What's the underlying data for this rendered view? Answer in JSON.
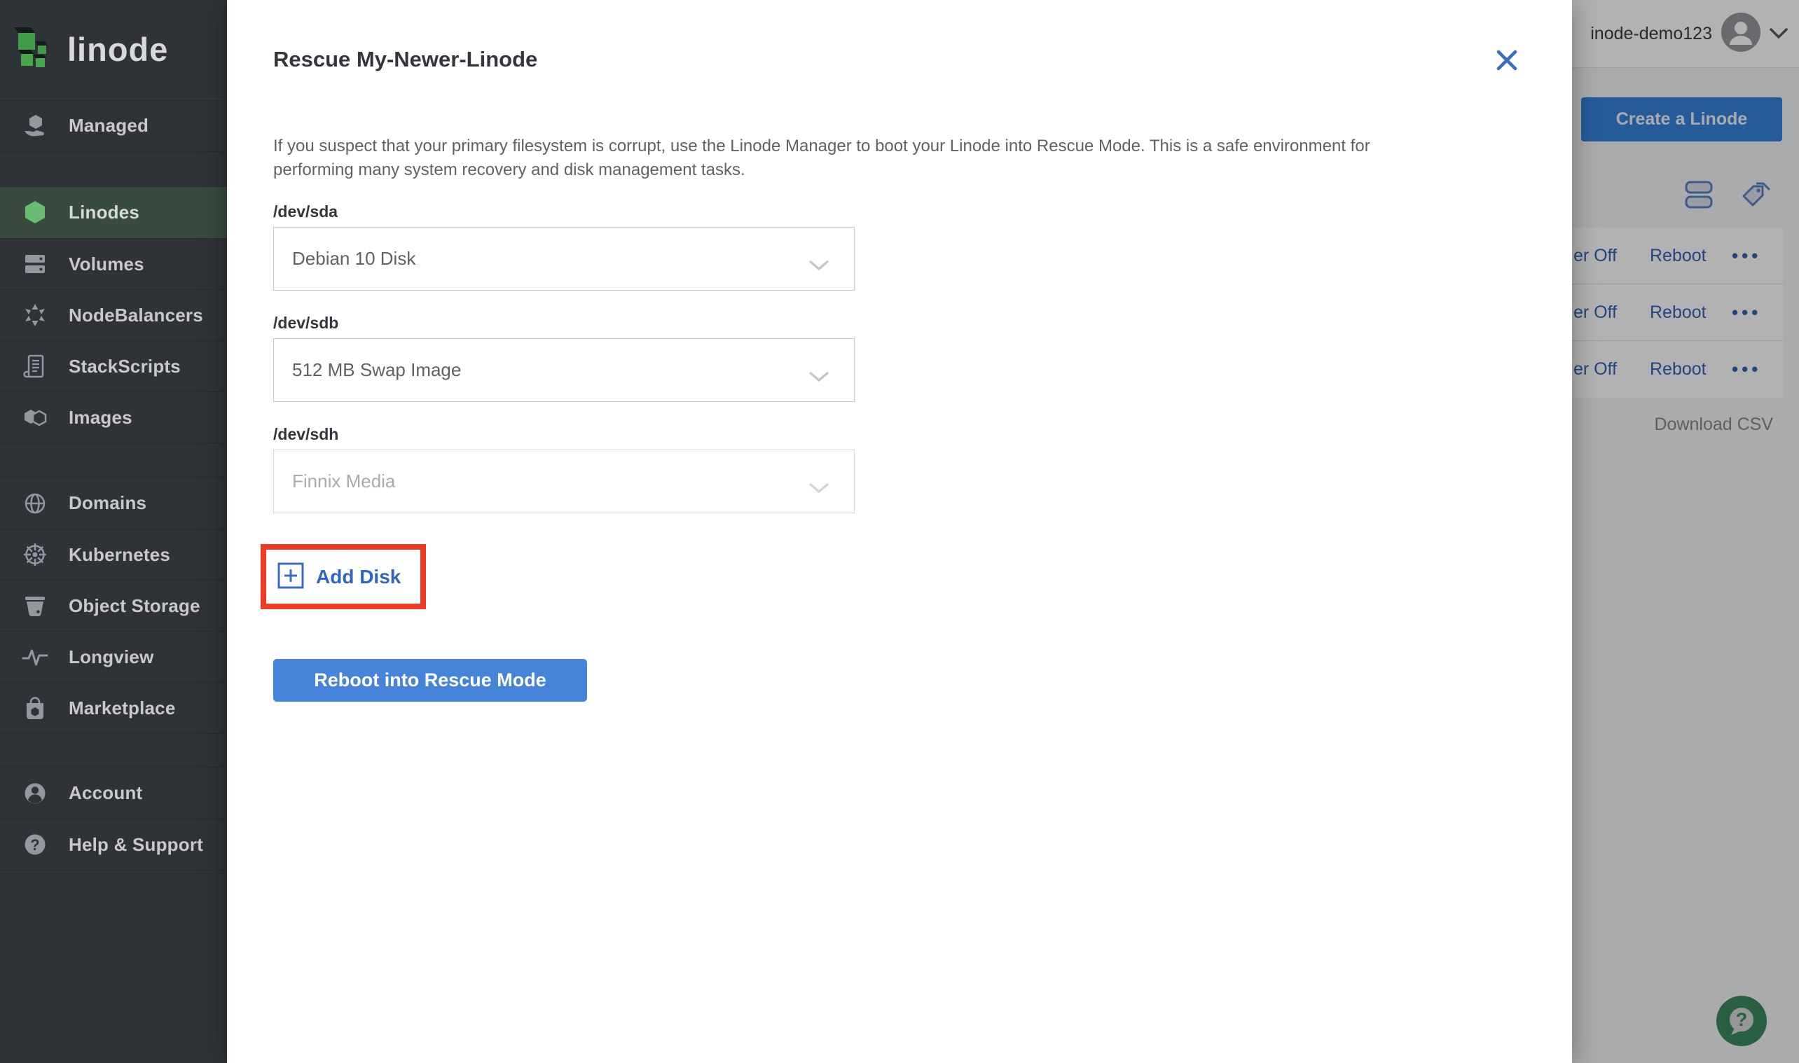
{
  "colors": {
    "accent_blue": "#3683dc",
    "link_blue": "#2f66c2",
    "sidebar_bg": "#2f3338",
    "active_green": "#6abc71",
    "annotation_red": "#ee3b23"
  },
  "sidebar": {
    "logo_text": "linode",
    "logo_icon": "linode-logo-icon",
    "groups": [
      {
        "items": [
          {
            "label": "Managed",
            "icon": "managed-icon",
            "active": false
          }
        ]
      },
      {
        "items": [
          {
            "label": "Linodes",
            "icon": "linodes-icon",
            "active": true
          },
          {
            "label": "Volumes",
            "icon": "volumes-icon",
            "active": false
          },
          {
            "label": "NodeBalancers",
            "icon": "nodebalancers-icon",
            "active": false
          },
          {
            "label": "StackScripts",
            "icon": "stackscripts-icon",
            "active": false
          },
          {
            "label": "Images",
            "icon": "images-icon",
            "active": false
          }
        ]
      },
      {
        "items": [
          {
            "label": "Domains",
            "icon": "domains-icon",
            "active": false
          },
          {
            "label": "Kubernetes",
            "icon": "kubernetes-icon",
            "active": false
          },
          {
            "label": "Object Storage",
            "icon": "object-storage-icon",
            "active": false
          },
          {
            "label": "Longview",
            "icon": "longview-icon",
            "active": false
          },
          {
            "label": "Marketplace",
            "icon": "marketplace-icon",
            "active": false
          }
        ]
      },
      {
        "items": [
          {
            "label": "Account",
            "icon": "account-icon",
            "active": false
          },
          {
            "label": "Help & Support",
            "icon": "help-icon",
            "active": false
          }
        ]
      }
    ]
  },
  "modal": {
    "title": "Rescue My-Newer-Linode",
    "close_icon": "close-icon",
    "description": "If you suspect that your primary filesystem is corrupt, use the Linode Manager to boot your Linode into Rescue Mode. This is a safe environment for performing many system recovery and disk management tasks.",
    "fields": [
      {
        "label": "/dev/sda",
        "value": "Debian 10 Disk",
        "disabled": false
      },
      {
        "label": "/dev/sdb",
        "value": "512 MB Swap Image",
        "disabled": false
      },
      {
        "label": "/dev/sdh",
        "value": "Finnix Media",
        "disabled": true
      }
    ],
    "add_disk": {
      "label": "Add Disk",
      "icon": "plus-box-icon",
      "annotated": true
    },
    "reboot_button_label": "Reboot into Rescue Mode"
  },
  "background_page": {
    "topbar": {
      "username": "inode-demo123",
      "avatar_icon": "avatar-icon",
      "chevron_icon": "chevron-down-icon"
    },
    "create_button_label": "Create a Linode",
    "toolbar_icons": [
      "summary-view-icon",
      "group-by-tag-icon"
    ],
    "table_rows": [
      {
        "power_label": "er Off",
        "reboot_label": "Reboot",
        "more_label": "•••"
      },
      {
        "power_label": "er Off",
        "reboot_label": "Reboot",
        "more_label": "•••"
      },
      {
        "power_label": "er Off",
        "reboot_label": "Reboot",
        "more_label": "•••"
      }
    ],
    "download_csv_label": "Download CSV",
    "help_fab_icon": "help-chat-icon"
  }
}
